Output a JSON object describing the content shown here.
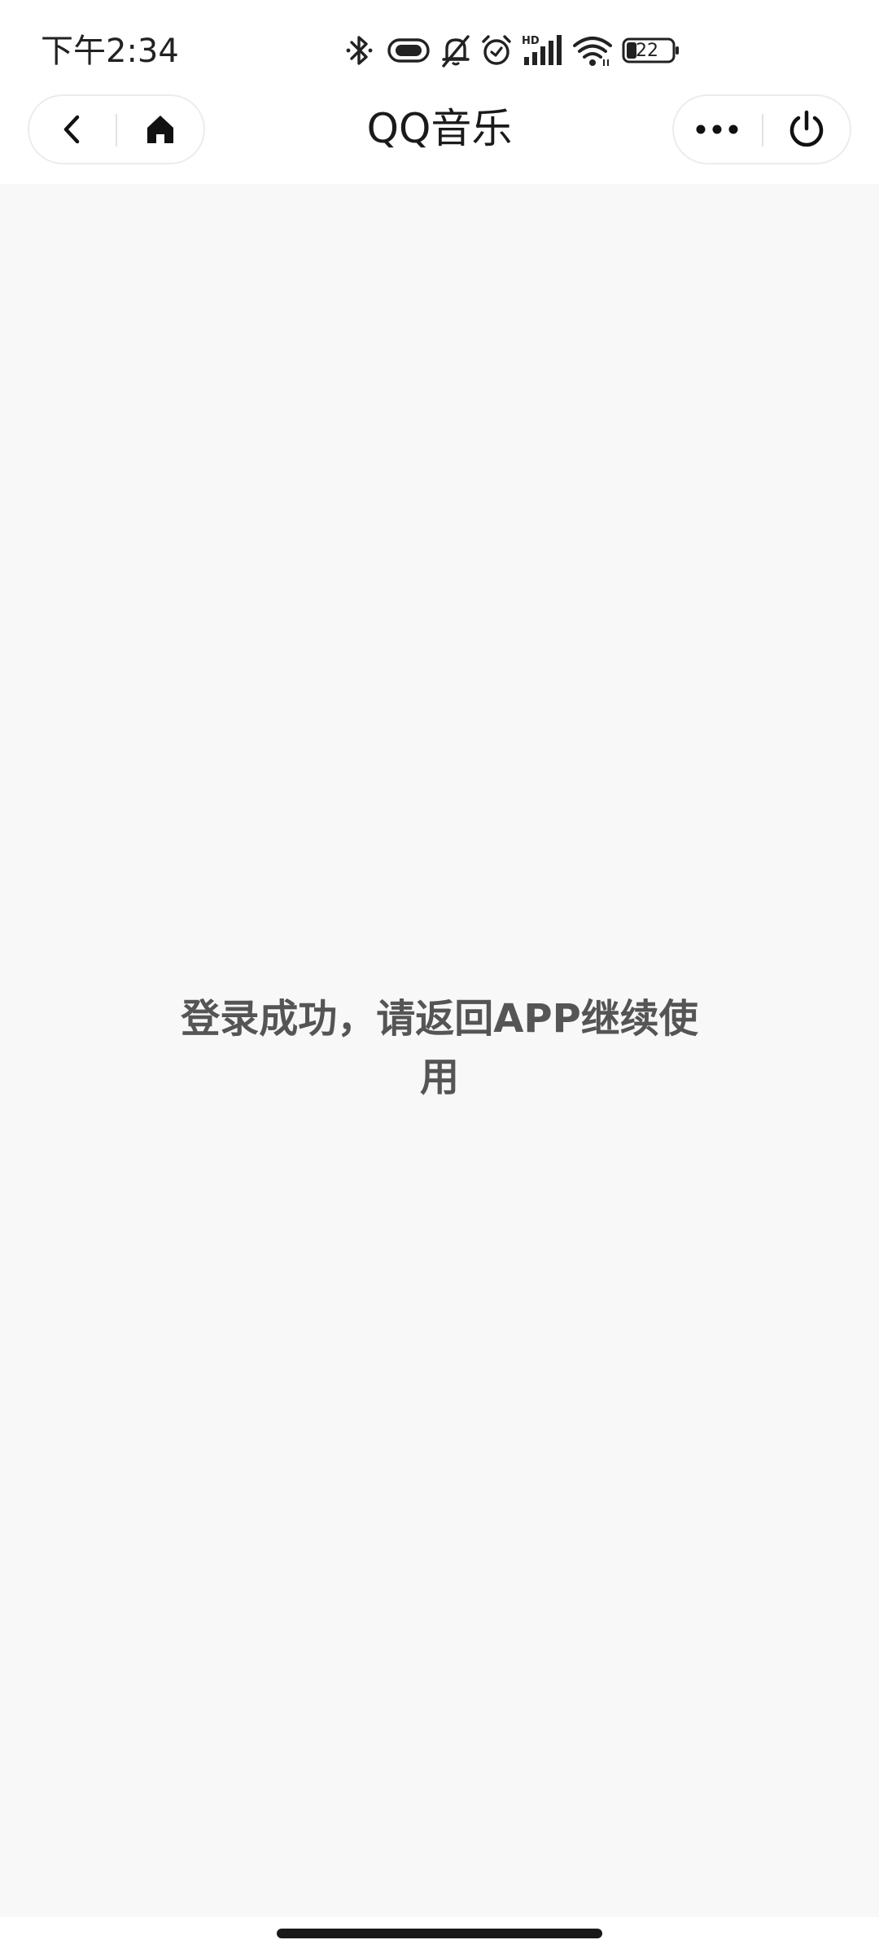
{
  "status_bar": {
    "time": "下午2:34",
    "battery_level": "22",
    "icons": [
      "bluetooth-icon",
      "vibrate-icon",
      "mute-icon",
      "alarm-icon",
      "signal-icon",
      "wifi-icon",
      "battery-icon"
    ],
    "network_badge": "HD"
  },
  "nav": {
    "title": "QQ音乐",
    "left_buttons": [
      "back-icon",
      "home-icon"
    ],
    "right_buttons": [
      "more-icon",
      "power-icon"
    ]
  },
  "main": {
    "message": "登录成功，请返回APP继续使用"
  },
  "colors": {
    "page_background": "#f8f8f8",
    "message_text": "#555555",
    "title_text": "#1a1a1a"
  }
}
